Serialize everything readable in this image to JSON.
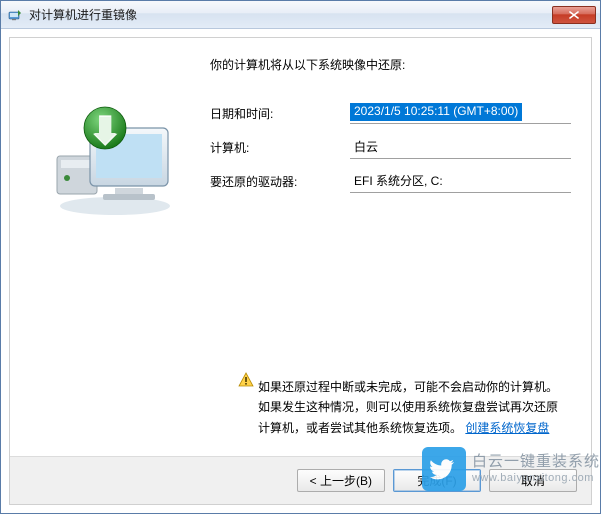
{
  "window": {
    "title": "对计算机进行重镜像"
  },
  "intro": "你的计算机将从以下系统映像中还原:",
  "fields": {
    "datetime_label": "日期和时间:",
    "datetime_value": "2023/1/5 10:25:11 (GMT+8:00)",
    "computer_label": "计算机:",
    "computer_value": "白云",
    "drives_label": "要还原的驱动器:",
    "drives_value": "EFI 系统分区, C:"
  },
  "warning": {
    "line1": "如果还原过程中断或未完成，可能不会启动你的计算机。",
    "line2a": "如果发生这种情况，则可以使用系统恢复盘尝试再次还原计算机，或者尝试其他系统恢复选项。",
    "link": "创建系统恢复盘"
  },
  "buttons": {
    "back": "< 上一步(B)",
    "finish": "完成(F)",
    "cancel": "取消"
  },
  "watermark": {
    "line1": "白云一键重装系统",
    "line2": "www.baiyunxitong.com"
  }
}
